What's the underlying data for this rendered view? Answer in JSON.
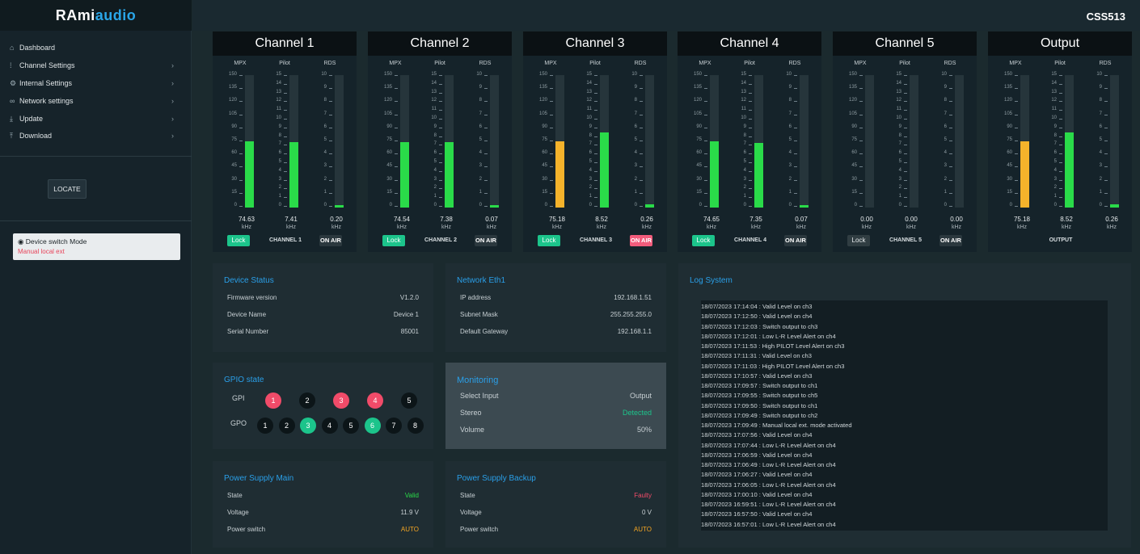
{
  "app": {
    "logo_main": "RAmi",
    "logo_accent": "audio",
    "model": "CSS513"
  },
  "sidebar": {
    "items": [
      {
        "icon": "home-icon",
        "glyph": "⌂",
        "label": "Dashboard",
        "chev": ""
      },
      {
        "icon": "sliders-icon",
        "glyph": "⁞",
        "label": "Channel Settings",
        "chev": "›"
      },
      {
        "icon": "gear-icon",
        "glyph": "⚙",
        "label": "Internal Settings",
        "chev": "›"
      },
      {
        "icon": "link-icon",
        "glyph": "∞",
        "label": "Network settings",
        "chev": "›"
      },
      {
        "icon": "download-icon",
        "glyph": "⤓",
        "label": "Update",
        "chev": "›"
      },
      {
        "icon": "upload-icon",
        "glyph": "⤒",
        "label": "Download",
        "chev": "›"
      }
    ],
    "locate": "LOCATE",
    "switch_title": "Device switch Mode",
    "switch_mode": "Manual local ext"
  },
  "meters": {
    "labels": {
      "mpx": "MPX",
      "pilot": "Pilot",
      "rds": "RDS"
    },
    "unit": "kHz",
    "mpx_ticks": [
      "150",
      "135",
      "120",
      "105",
      "90",
      "75",
      "60",
      "45",
      "30",
      "15",
      "0"
    ],
    "pilot_ticks": [
      "15",
      "14",
      "13",
      "12",
      "11",
      "10",
      "9",
      "8",
      "7",
      "6",
      "5",
      "4",
      "3",
      "2",
      "1",
      "0"
    ],
    "rds_ticks": [
      "10",
      "9",
      "8",
      "7",
      "6",
      "5",
      "4",
      "3",
      "2",
      "1",
      "0"
    ],
    "channels": [
      {
        "title": "Channel 1",
        "name": "CHANNEL 1",
        "mpx": "74.63",
        "pilot": "7.41",
        "rds": "0.20",
        "mpx_v": 74.63,
        "pilot_v": 7.41,
        "rds_v": 0.2,
        "mpx_color": "#2adb49",
        "lock": "Lock",
        "lock_on": true,
        "onair": "ON AIR",
        "onair_alert": false
      },
      {
        "title": "Channel 2",
        "name": "CHANNEL 2",
        "mpx": "74.54",
        "pilot": "7.38",
        "rds": "0.07",
        "mpx_v": 74.54,
        "pilot_v": 7.38,
        "rds_v": 0.07,
        "mpx_color": "#2adb49",
        "lock": "Lock",
        "lock_on": true,
        "onair": "ON AIR",
        "onair_alert": false
      },
      {
        "title": "Channel 3",
        "name": "CHANNEL 3",
        "mpx": "75.18",
        "pilot": "8.52",
        "rds": "0.26",
        "mpx_v": 75.18,
        "pilot_v": 8.52,
        "rds_v": 0.26,
        "mpx_color": "#f5b32b",
        "lock": "Lock",
        "lock_on": true,
        "onair": "ON AIR",
        "onair_alert": true
      },
      {
        "title": "Channel 4",
        "name": "CHANNEL 4",
        "mpx": "74.65",
        "pilot": "7.35",
        "rds": "0.07",
        "mpx_v": 74.65,
        "pilot_v": 7.35,
        "rds_v": 0.07,
        "mpx_color": "#2adb49",
        "lock": "Lock",
        "lock_on": true,
        "onair": "ON AIR",
        "onair_alert": false
      },
      {
        "title": "Channel 5",
        "name": "CHANNEL 5",
        "mpx": "0.00",
        "pilot": "0.00",
        "rds": "0.00",
        "mpx_v": 0,
        "pilot_v": 0,
        "rds_v": 0,
        "mpx_color": "#2adb49",
        "lock": "Lock",
        "lock_on": false,
        "onair": "ON AIR",
        "onair_alert": false
      },
      {
        "title": "Output",
        "name": "OUTPUT",
        "mpx": "75.18",
        "pilot": "8.52",
        "rds": "0.26",
        "mpx_v": 75.18,
        "pilot_v": 8.52,
        "rds_v": 0.26,
        "mpx_color": "#f5b32b",
        "lock": "",
        "lock_on": false,
        "onair": "",
        "onair_alert": false
      }
    ]
  },
  "device_status": {
    "title": "Device Status",
    "rows": [
      [
        "Firmware version",
        "V1.2.0"
      ],
      [
        "Device Name",
        "Device 1"
      ],
      [
        "Serial Number",
        "85001"
      ]
    ]
  },
  "network": {
    "title": "Network Eth1",
    "rows": [
      [
        "IP address",
        "192.168.1.51"
      ],
      [
        "Subnet Mask",
        "255.255.255.0"
      ],
      [
        "Default Gateway",
        "192.168.1.1"
      ]
    ]
  },
  "gpio": {
    "title": "GPIO state",
    "gpi_label": "GPI",
    "gpo_label": "GPO",
    "gpi": [
      {
        "n": "1",
        "state": "red"
      },
      {
        "n": "2",
        "state": "off"
      },
      {
        "n": "3",
        "state": "red"
      },
      {
        "n": "4",
        "state": "red"
      },
      {
        "n": "5",
        "state": "off"
      }
    ],
    "gpo": [
      {
        "n": "1",
        "state": "off"
      },
      {
        "n": "2",
        "state": "off"
      },
      {
        "n": "3",
        "state": "green"
      },
      {
        "n": "4",
        "state": "off"
      },
      {
        "n": "5",
        "state": "off"
      },
      {
        "n": "6",
        "state": "green"
      },
      {
        "n": "7",
        "state": "off"
      },
      {
        "n": "8",
        "state": "off"
      }
    ]
  },
  "monitoring": {
    "title": "Monitoring",
    "rows": [
      [
        "Select Input",
        "Output"
      ],
      [
        "Stereo",
        "Detected"
      ],
      [
        "Volume",
        "50%"
      ]
    ]
  },
  "psu_main": {
    "title": "Power Supply Main",
    "rows": [
      [
        "State",
        "Valid"
      ],
      [
        "Voltage",
        "11.9 V"
      ],
      [
        "Power switch",
        "AUTO"
      ]
    ]
  },
  "psu_backup": {
    "title": "Power Supply Backup",
    "rows": [
      [
        "State",
        "Faulty"
      ],
      [
        "Voltage",
        "0 V"
      ],
      [
        "Power switch",
        "AUTO"
      ]
    ]
  },
  "colors": {
    "valid": "#2adb49",
    "faulty": "#f14b69",
    "auto": "#f5a623",
    "detected": "#1cc48b"
  },
  "log": {
    "title": "Log System",
    "lines": [
      "18/07/2023 17:14:04 : Valid Level on ch3",
      "18/07/2023 17:12:50 : Valid Level on ch4",
      "18/07/2023 17:12:03 : Switch output to ch3",
      "18/07/2023 17:12:01 : Low L-R Level Alert on ch4",
      "18/07/2023 17:11:53 : High PILOT Level Alert on ch3",
      "18/07/2023 17:11:31 : Valid Level on ch3",
      "18/07/2023 17:11:03 : High PILOT Level Alert on ch3",
      "18/07/2023 17:10:57 : Valid Level on ch3",
      "18/07/2023 17:09:57 : Switch output to ch1",
      "18/07/2023 17:09:55 : Switch output to ch5",
      "18/07/2023 17:09:50 : Switch output to ch1",
      "18/07/2023 17:09:49 : Switch output to ch2",
      "18/07/2023 17:09:49 : Manual local ext. mode activated",
      "18/07/2023 17:07:56 : Valid Level on ch4",
      "18/07/2023 17:07:44 : Low L-R Level Alert on ch4",
      "18/07/2023 17:06:59 : Valid Level on ch4",
      "18/07/2023 17:06:49 : Low L-R Level Alert on ch4",
      "18/07/2023 17:06:27 : Valid Level on ch4",
      "18/07/2023 17:06:05 : Low L-R Level Alert on ch4",
      "18/07/2023 17:00:10 : Valid Level on ch4",
      "18/07/2023 16:59:51 : Low L-R Level Alert on ch4",
      "18/07/2023 16:57:50 : Valid Level on ch4",
      "18/07/2023 16:57:01 : Low L-R Level Alert on ch4"
    ]
  }
}
